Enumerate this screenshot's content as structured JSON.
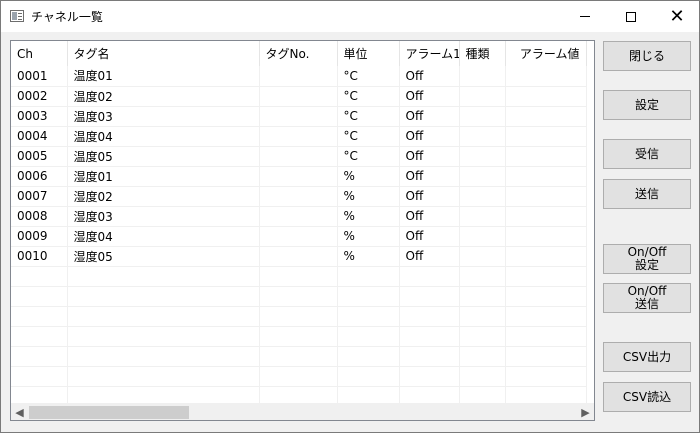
{
  "window": {
    "title": "チャネル一覧",
    "controls": {
      "minimize_icon": "minimize-icon",
      "maximize_icon": "maximize-icon",
      "close_icon": "close-icon"
    }
  },
  "grid": {
    "columns": [
      "Ch",
      "タグ名",
      "タグNo.",
      "単位",
      "アラーム1",
      "種類",
      "アラーム値"
    ],
    "rows": [
      [
        "0001",
        "温度01",
        "",
        "°C",
        "Off",
        "",
        ""
      ],
      [
        "0002",
        "温度02",
        "",
        "°C",
        "Off",
        "",
        ""
      ],
      [
        "0003",
        "温度03",
        "",
        "°C",
        "Off",
        "",
        ""
      ],
      [
        "0004",
        "温度04",
        "",
        "°C",
        "Off",
        "",
        ""
      ],
      [
        "0005",
        "温度05",
        "",
        "°C",
        "Off",
        "",
        ""
      ],
      [
        "0006",
        "湿度01",
        "",
        "%",
        "Off",
        "",
        ""
      ],
      [
        "0007",
        "湿度02",
        "",
        "%",
        "Off",
        "",
        ""
      ],
      [
        "0008",
        "湿度03",
        "",
        "%",
        "Off",
        "",
        ""
      ],
      [
        "0009",
        "湿度04",
        "",
        "%",
        "Off",
        "",
        ""
      ],
      [
        "0010",
        "湿度05",
        "",
        "%",
        "Off",
        "",
        ""
      ]
    ],
    "empty_row_count": 7
  },
  "buttons": {
    "close": "閉じる",
    "settings": "設定",
    "receive": "受信",
    "send": "送信",
    "onoff_settings": "On/Off\n設定",
    "onoff_send": "On/Off\n送信",
    "csv_export": "CSV出力",
    "csv_import": "CSV読込"
  },
  "colors": {
    "window_bg": "#f0f0f0",
    "grid_bg": "#ffffff",
    "button_bg": "#e1e1e1",
    "button_border": "#adadad",
    "gridline": "#f0f0f0"
  }
}
